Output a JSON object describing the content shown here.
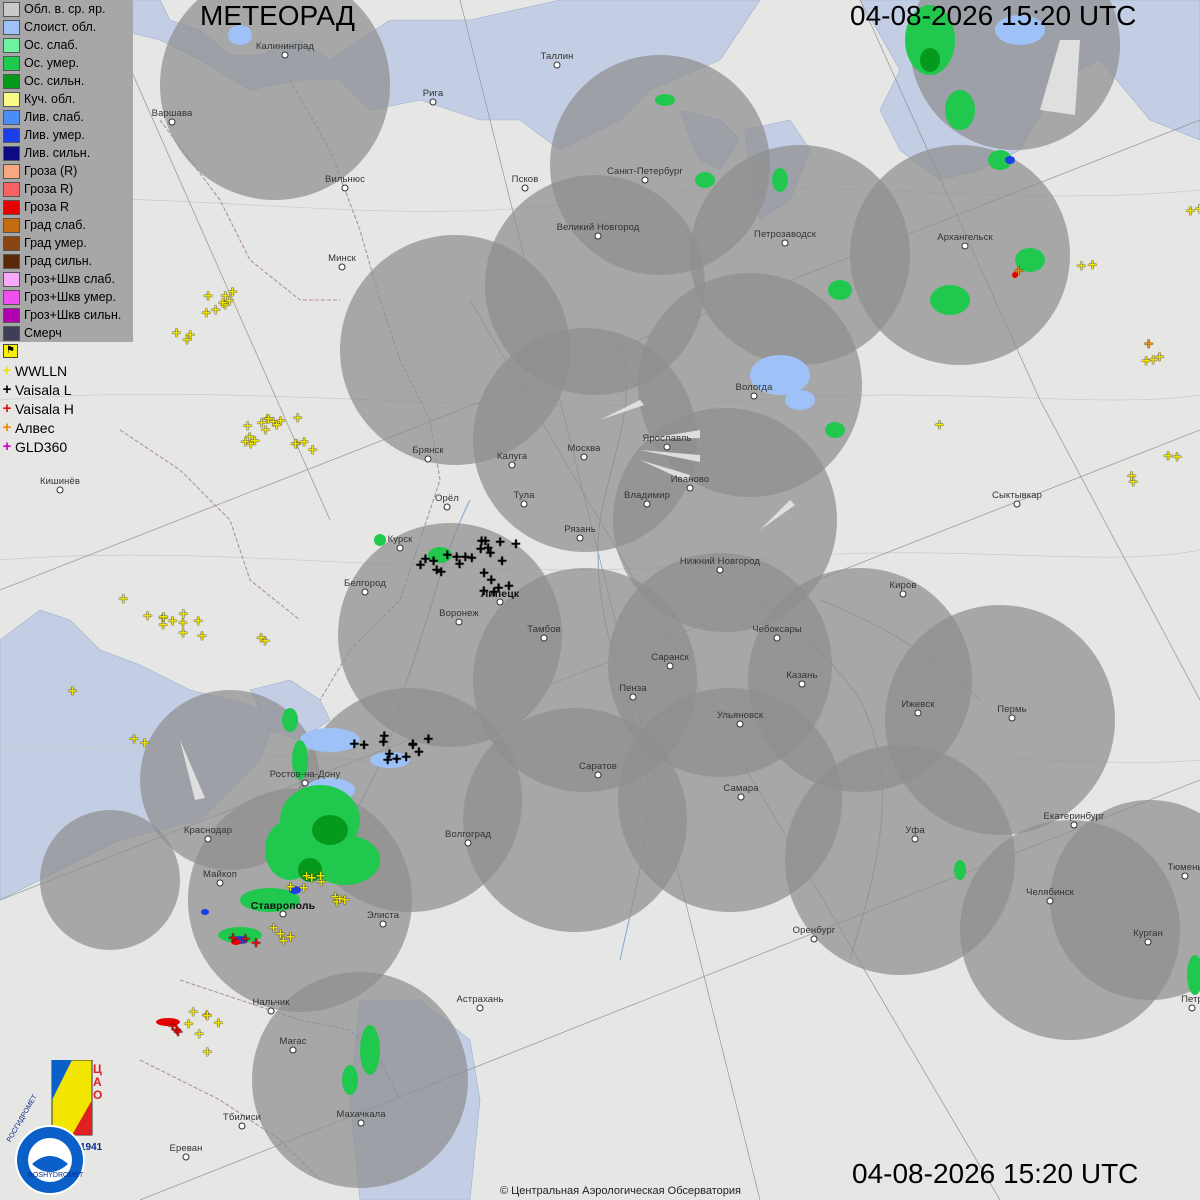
{
  "header": {
    "title": "МЕТЕОРАД",
    "timestamp_top": "04-08-2026  15:20 UTC",
    "timestamp_bottom": "04-08-2026  15:20 UTC"
  },
  "footer": {
    "copyright": "© Центральная Аэрологическая Обсерватория"
  },
  "legend": {
    "items": [
      {
        "label": "Обл. в. ср. яр.",
        "color": "#c9c9c9"
      },
      {
        "label": "Слоист. обл.",
        "color": "#9ec2f7"
      },
      {
        "label": "Ос. слаб.",
        "color": "#6ef2a0"
      },
      {
        "label": "Ос. умер.",
        "color": "#21c84e"
      },
      {
        "label": "Ос. сильн.",
        "color": "#069a1d"
      },
      {
        "label": "Куч. обл.",
        "color": "#f9f98a"
      },
      {
        "label": "Лив. слаб.",
        "color": "#4a8ef5"
      },
      {
        "label": "Лив. умер.",
        "color": "#1a3fe8"
      },
      {
        "label": "Лив. сильн.",
        "color": "#0b0b82"
      },
      {
        "label": "Гроза (R)",
        "color": "#f7a880"
      },
      {
        "label": "Гроза R)",
        "color": "#f76363"
      },
      {
        "label": "Гроза R",
        "color": "#e60000"
      },
      {
        "label": "Град слаб.",
        "color": "#c46a0f"
      },
      {
        "label": "Град умер.",
        "color": "#8b4513"
      },
      {
        "label": "Град сильн.",
        "color": "#5a2a08"
      },
      {
        "label": "Гроз+Шкв слаб.",
        "color": "#f7a8f7"
      },
      {
        "label": "Гроз+Шкв умер.",
        "color": "#f050f0"
      },
      {
        "label": "Гроз+Шкв сильн.",
        "color": "#b000b0"
      },
      {
        "label": "Смерч",
        "color": "#3e3e56"
      }
    ]
  },
  "lightning_legend": {
    "toggle_icon": "flag-icon",
    "items": [
      {
        "label": "WWLLN",
        "color": "#f2e600"
      },
      {
        "label": "Vaisala L",
        "color": "#000000"
      },
      {
        "label": "Vaisala H",
        "color": "#e01010"
      },
      {
        "label": "Алвес",
        "color": "#f08a00"
      },
      {
        "label": "GLD360",
        "color": "#d000d0"
      }
    ]
  },
  "cities": [
    {
      "name": "Калининград",
      "big": false
    },
    {
      "name": "Таллин",
      "big": false
    },
    {
      "name": "Рига",
      "big": false
    },
    {
      "name": "Варшава",
      "big": false
    },
    {
      "name": "Вильнюс",
      "big": false
    },
    {
      "name": "Псков",
      "big": false
    },
    {
      "name": "Санкт-Петербург",
      "big": false
    },
    {
      "name": "Петрозаводск",
      "big": false
    },
    {
      "name": "Архангельск",
      "big": false
    },
    {
      "name": "Великий Новгород",
      "big": false
    },
    {
      "name": "Минск",
      "big": false
    },
    {
      "name": "Вологда",
      "big": false
    },
    {
      "name": "Ярославль",
      "big": false
    },
    {
      "name": "Брянск",
      "big": false
    },
    {
      "name": "Калуга",
      "big": false
    },
    {
      "name": "Москва",
      "big": false
    },
    {
      "name": "Иваново",
      "big": false
    },
    {
      "name": "Кишинёв",
      "big": false
    },
    {
      "name": "Тула",
      "big": false
    },
    {
      "name": "Орёл",
      "big": false
    },
    {
      "name": "Владимир",
      "big": false
    },
    {
      "name": "Сыктывкар",
      "big": false
    },
    {
      "name": "Рязань",
      "big": false
    },
    {
      "name": "Курск",
      "big": false
    },
    {
      "name": "Нижний Новгород",
      "big": false
    },
    {
      "name": "Липецк",
      "big": true
    },
    {
      "name": "Белгород",
      "big": false
    },
    {
      "name": "Киров",
      "big": false
    },
    {
      "name": "Воронеж",
      "big": false
    },
    {
      "name": "Тамбов",
      "big": false
    },
    {
      "name": "Чебоксары",
      "big": false
    },
    {
      "name": "Саранск",
      "big": false
    },
    {
      "name": "Казань",
      "big": false
    },
    {
      "name": "Пенза",
      "big": false
    },
    {
      "name": "Ижевск",
      "big": false
    },
    {
      "name": "Пермь",
      "big": false
    },
    {
      "name": "Ульяновск",
      "big": false
    },
    {
      "name": "Ростов-на-Дону",
      "big": false
    },
    {
      "name": "Саратов",
      "big": false
    },
    {
      "name": "Самара",
      "big": false
    },
    {
      "name": "Екатеринбург",
      "big": false
    },
    {
      "name": "Краснодар",
      "big": false
    },
    {
      "name": "Волгоград",
      "big": false
    },
    {
      "name": "Уфа",
      "big": false
    },
    {
      "name": "Тюмень",
      "big": false
    },
    {
      "name": "Майкоп",
      "big": false
    },
    {
      "name": "Челябинск",
      "big": false
    },
    {
      "name": "Ставрополь",
      "big": true
    },
    {
      "name": "Элиста",
      "big": false
    },
    {
      "name": "Оренбург",
      "big": false
    },
    {
      "name": "Курган",
      "big": false
    },
    {
      "name": "Петр",
      "big": false
    },
    {
      "name": "Астрахань",
      "big": false
    },
    {
      "name": "Нальчик",
      "big": false
    },
    {
      "name": "Магас",
      "big": false
    },
    {
      "name": "Тбилиси",
      "big": false
    },
    {
      "name": "Махачкала",
      "big": false
    },
    {
      "name": "Ереван",
      "big": false
    }
  ],
  "logo": {
    "org_text_top": "РОСГИДРОМЕТ",
    "org_text_bottom": "ROSHYDROMET",
    "badge_text": "ЦАО",
    "year_text": "1941"
  }
}
